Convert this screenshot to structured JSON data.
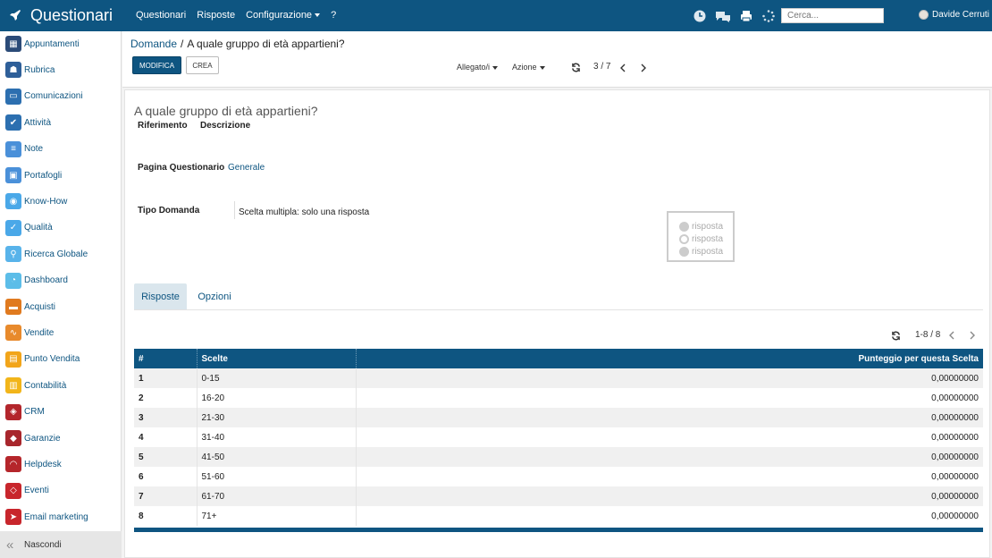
{
  "header": {
    "app_title": "Questionari",
    "menu": [
      "Questionari",
      "Risposte",
      "Configurazione",
      "?"
    ],
    "search_placeholder": "Cerca...",
    "user": "Davide Cerruti",
    "icons": [
      "clock-icon",
      "chat-icon",
      "print-icon",
      "spinner-icon"
    ]
  },
  "sidebar": {
    "items": [
      {
        "label": "Appuntamenti",
        "icon": "calendar-icon",
        "color": "#2b4b78"
      },
      {
        "label": "Rubrica",
        "icon": "contacts-icon",
        "color": "#2e5f99"
      },
      {
        "label": "Comunicazioni",
        "icon": "chat-icon",
        "color": "#2c6fb0"
      },
      {
        "label": "Attività",
        "icon": "checkmark-icon",
        "color": "#2c6fb0"
      },
      {
        "label": "Note",
        "icon": "note-icon",
        "color": "#4a90d9"
      },
      {
        "label": "Portafogli",
        "icon": "lock-icon",
        "color": "#4a90d9"
      },
      {
        "label": "Know-How",
        "icon": "lightbulb-icon",
        "color": "#4aa8e8"
      },
      {
        "label": "Qualità",
        "icon": "quality-icon",
        "color": "#4aa8e8"
      },
      {
        "label": "Ricerca Globale",
        "icon": "search-icon",
        "color": "#58b3ea"
      },
      {
        "label": "Dashboard",
        "icon": "dashboard-icon",
        "color": "#5cbde8"
      },
      {
        "label": "Acquisti",
        "icon": "cart-icon",
        "color": "#e07a1f"
      },
      {
        "label": "Vendite",
        "icon": "chart-icon",
        "color": "#e88a2c"
      },
      {
        "label": "Punto Vendita",
        "icon": "pos-icon",
        "color": "#f2a51a"
      },
      {
        "label": "Contabilità",
        "icon": "ledger-icon",
        "color": "#f2b51a"
      },
      {
        "label": "CRM",
        "icon": "handshake-icon",
        "color": "#b3262c"
      },
      {
        "label": "Garanzie",
        "icon": "shield-icon",
        "color": "#a8262c"
      },
      {
        "label": "Helpdesk",
        "icon": "headset-icon",
        "color": "#b5262b"
      },
      {
        "label": "Eventi",
        "icon": "ticket-icon",
        "color": "#c8262c"
      },
      {
        "label": "Email marketing",
        "icon": "paper-plane-icon",
        "color": "#c8262c"
      }
    ],
    "footer_label": "Nascondi"
  },
  "control": {
    "breadcrumb_parent": "Domande",
    "breadcrumb_sep": "/",
    "breadcrumb_current": "A quale gruppo di età appartieni?",
    "edit_label": "MODIFICA",
    "create_label": "CREA",
    "attachment_label": "Allegato/i",
    "action_label": "Azione",
    "record_pager": "3 / 7"
  },
  "form": {
    "title": "A quale gruppo di età appartieni?",
    "reference_label": "Riferimento",
    "description_label": "Descrizione",
    "page_label": "Pagina Questionario",
    "page_value": "Generale",
    "type_label": "Tipo Domanda",
    "type_value": "Scelta multipla: solo una risposta",
    "preview_rows": [
      "risposta",
      "risposta",
      "risposta"
    ]
  },
  "tabs": [
    "Risposte",
    "Opzioni"
  ],
  "answers": {
    "pager": "1-8 / 8",
    "columns": [
      "#",
      "Scelte",
      "Punteggio per questa Scelta"
    ],
    "rows": [
      {
        "n": "1",
        "choice": "0-15",
        "score": "0,00000000"
      },
      {
        "n": "2",
        "choice": "16-20",
        "score": "0,00000000"
      },
      {
        "n": "3",
        "choice": "21-30",
        "score": "0,00000000"
      },
      {
        "n": "4",
        "choice": "31-40",
        "score": "0,00000000"
      },
      {
        "n": "5",
        "choice": "41-50",
        "score": "0,00000000"
      },
      {
        "n": "6",
        "choice": "51-60",
        "score": "0,00000000"
      },
      {
        "n": "7",
        "choice": "61-70",
        "score": "0,00000000"
      },
      {
        "n": "8",
        "choice": "71+",
        "score": "0,00000000"
      }
    ]
  }
}
